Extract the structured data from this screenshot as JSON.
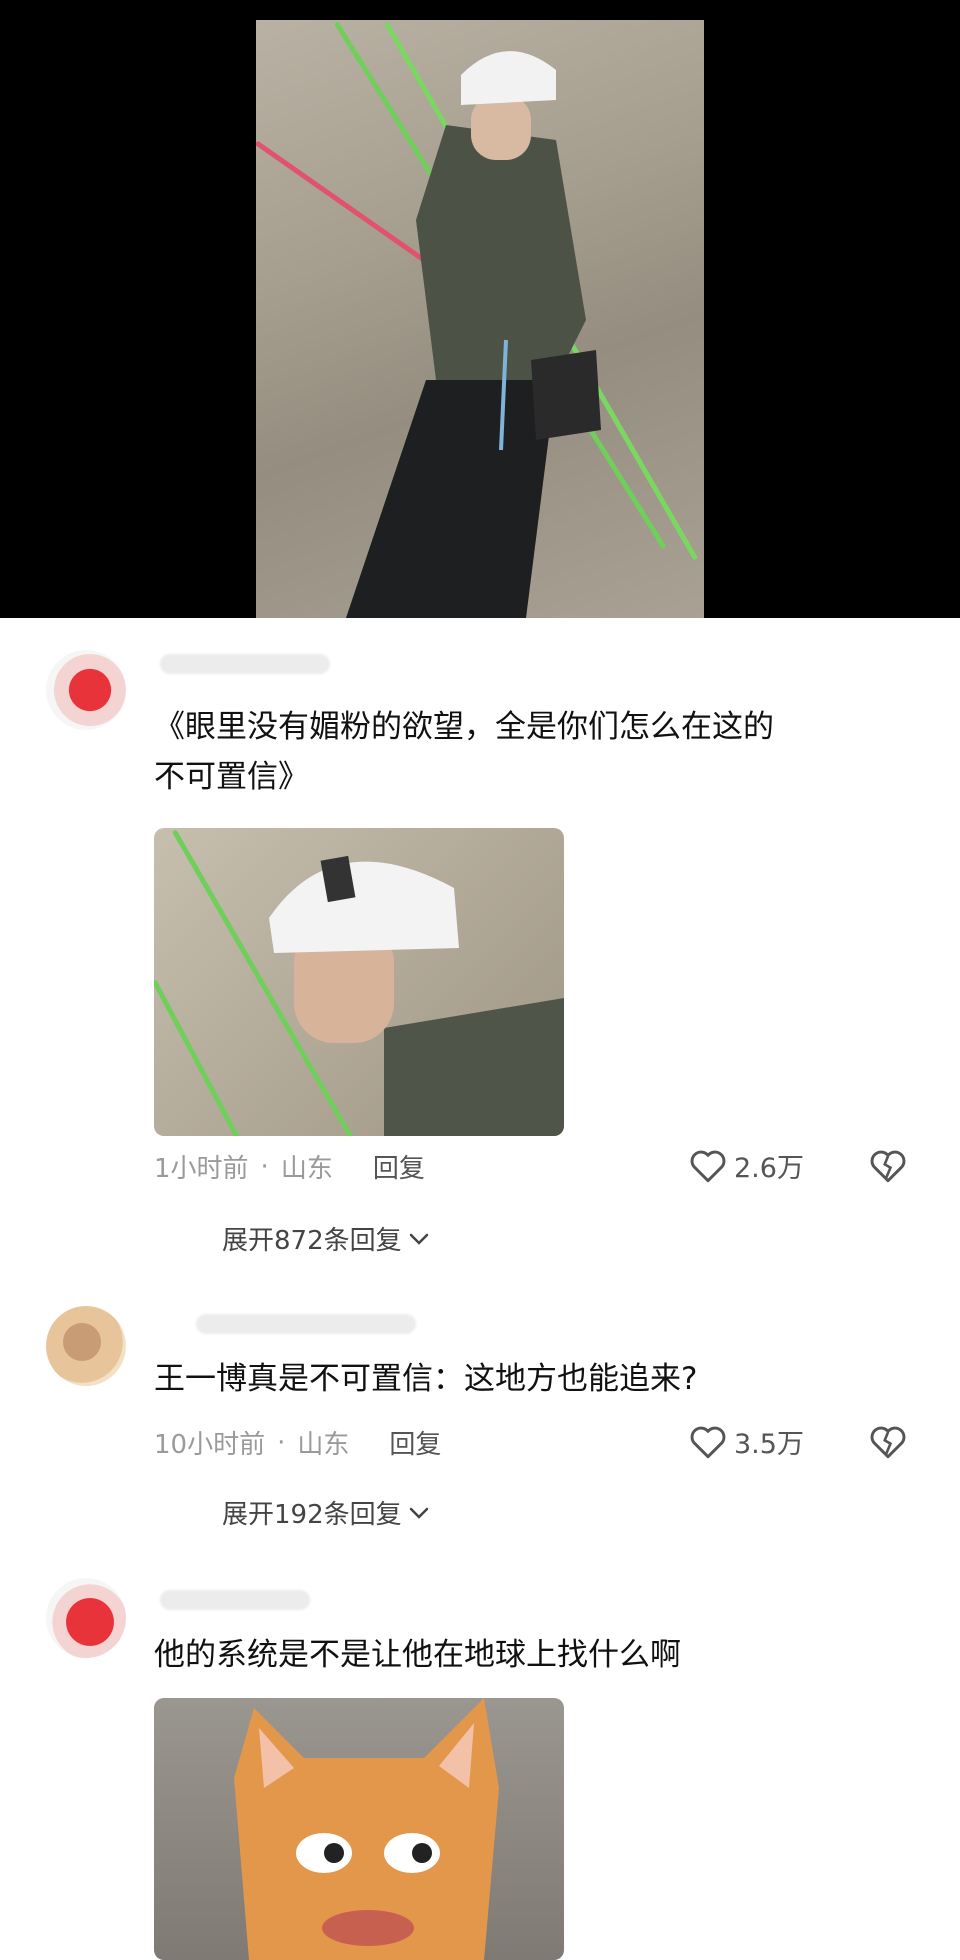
{
  "comments": [
    {
      "text_line1": "《眼里没有媚粉的欲望，全是你们怎么在这的",
      "text_line2": "不可置信》",
      "time": "1小时前",
      "location": "山东",
      "reply_label": "回复",
      "likes": "2.6万",
      "expand_label": "展开872条回复",
      "image": "helmet-closeup-photo"
    },
    {
      "text_line1": "王一博真是不可置信：这地方也能追来?",
      "time": "10小时前",
      "location": "山东",
      "reply_label": "回复",
      "likes": "3.5万",
      "expand_label": "展开192条回复"
    },
    {
      "text_line1": "他的系统是不是让他在地球上找什么啊",
      "image": "cat-face-meme-photo"
    }
  ],
  "meta_separator": "·",
  "colors": {
    "background": "#ffffff",
    "muted_text": "#9a9a9a",
    "video_bg": "#000000",
    "rope_green": "#6fcf5a",
    "rope_pink": "#e0526e"
  },
  "icons": [
    "heart-outline-icon",
    "broken-heart-icon",
    "chevron-down-icon"
  ]
}
